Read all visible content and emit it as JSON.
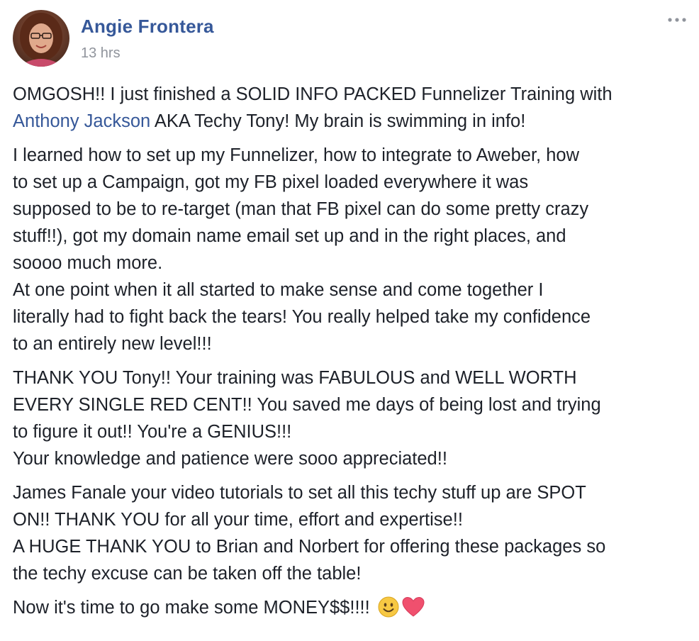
{
  "post": {
    "author_name": "Angie Frontera",
    "timestamp": "13 hrs",
    "more_icon": "ellipsis-icon",
    "paragraphs": [
      {
        "lines": [
          {
            "parts": [
              "OMGOSH!! I just finished a SOLID INFO PACKED Funnelizer Training with"
            ]
          },
          {
            "mention": "Anthony Jackson",
            "after": " AKA Techy Tony! My brain is swimming in info!"
          }
        ]
      },
      {
        "lines": [
          "I learned how to set up my Funnelizer, how to integrate to Aweber, how",
          "to set up a Campaign, got my FB pixel loaded everywhere it was",
          "supposed to be to re-target (man that FB pixel can do some pretty crazy",
          "stuff!!), got my domain name email set up and in the right places, and",
          "soooo much more.",
          "At one point when it all started to make sense and come together I",
          "literally had to fight back the tears! You really helped take my confidence",
          "to an entirely new level!!!"
        ]
      },
      {
        "lines": [
          "THANK YOU Tony!! Your training was FABULOUS and WELL WORTH",
          "EVERY SINGLE RED CENT!! You saved me days of being lost and trying",
          "to figure it out!! You're a GENIUS!!!",
          "Your knowledge and patience were sooo appreciated!!"
        ]
      },
      {
        "lines": [
          "James Fanale your video tutorials to set all this techy stuff up are SPOT",
          "ON!! THANK YOU for all your time, effort and expertise!!",
          "A HUGE THANK YOU to Brian and Norbert for offering these packages so",
          "the techy excuse can be taken off the table!"
        ]
      },
      {
        "lines": [
          "Now it's time to go make some MONEY$$!!!! "
        ],
        "emojis": [
          "smiley-emoji-icon",
          "heart-emoji-icon"
        ]
      }
    ]
  },
  "colors": {
    "link": "#365899",
    "text": "#1d2129",
    "meta": "#90949c",
    "heart": "#f0506e",
    "smiley": "#f7c843"
  }
}
